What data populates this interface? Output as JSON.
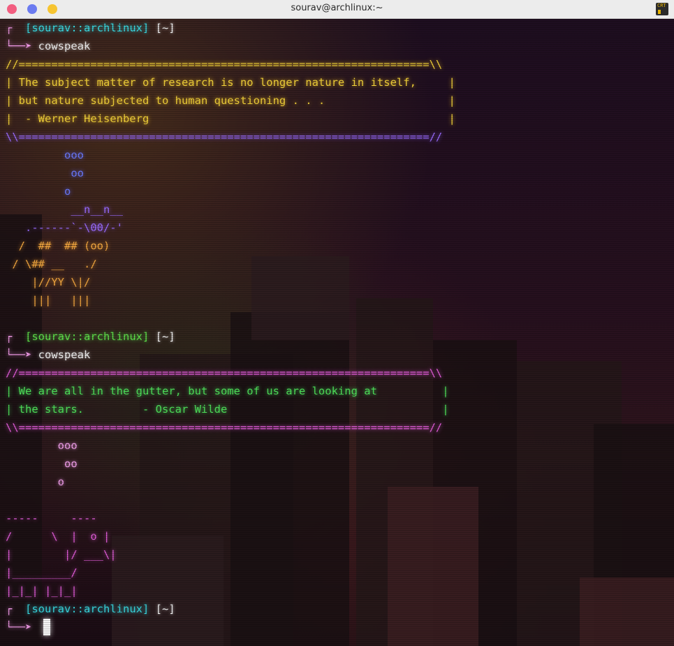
{
  "window": {
    "title": "sourav@archlinux:~",
    "crt_icon_label": "CRT"
  },
  "colors": {
    "titlebar": "#ececec",
    "close": "#f25e80",
    "minimize": "#6b7bf0",
    "maximize": "#f6c431"
  },
  "prompt": {
    "bracket_top": "┌",
    "arrow": "└──➤",
    "user_host": "[sourav::archlinux]",
    "dir": "[~]"
  },
  "session1": {
    "command": "cowspeak",
    "box_top": "//===============================================================\\\\",
    "quote_l1": "| The subject matter of research is no longer nature in itself,     |",
    "quote_l2": "| but nature subjected to human questioning . . .                   |",
    "quote_l3": "|  - Werner Heisenberg                                              |",
    "box_bottom": "\\\\===============================================================//",
    "art": [
      "         ooo",
      "          oo",
      "         o",
      "",
      "          __n__n__",
      "   .------`-\\00/-'",
      "  /  ##  ## (oo)",
      " / \\## __   ./",
      "    |//YY \\|/",
      "    |||   |||"
    ]
  },
  "session2": {
    "command": "cowspeak",
    "box_top": "//===============================================================\\\\",
    "quote_l1": "| We are all in the gutter, but some of us are looking at          |",
    "quote_l2": "| the stars.         - Oscar Wilde                                 |",
    "box_bottom": "\\\\===============================================================//",
    "art": [
      "        ooo",
      "         oo",
      "        o",
      "",
      "-----     ----",
      "/      \\  |  o |",
      "|        |/ ___\\|",
      "|_________/",
      "|_|_| |_|_|"
    ]
  }
}
